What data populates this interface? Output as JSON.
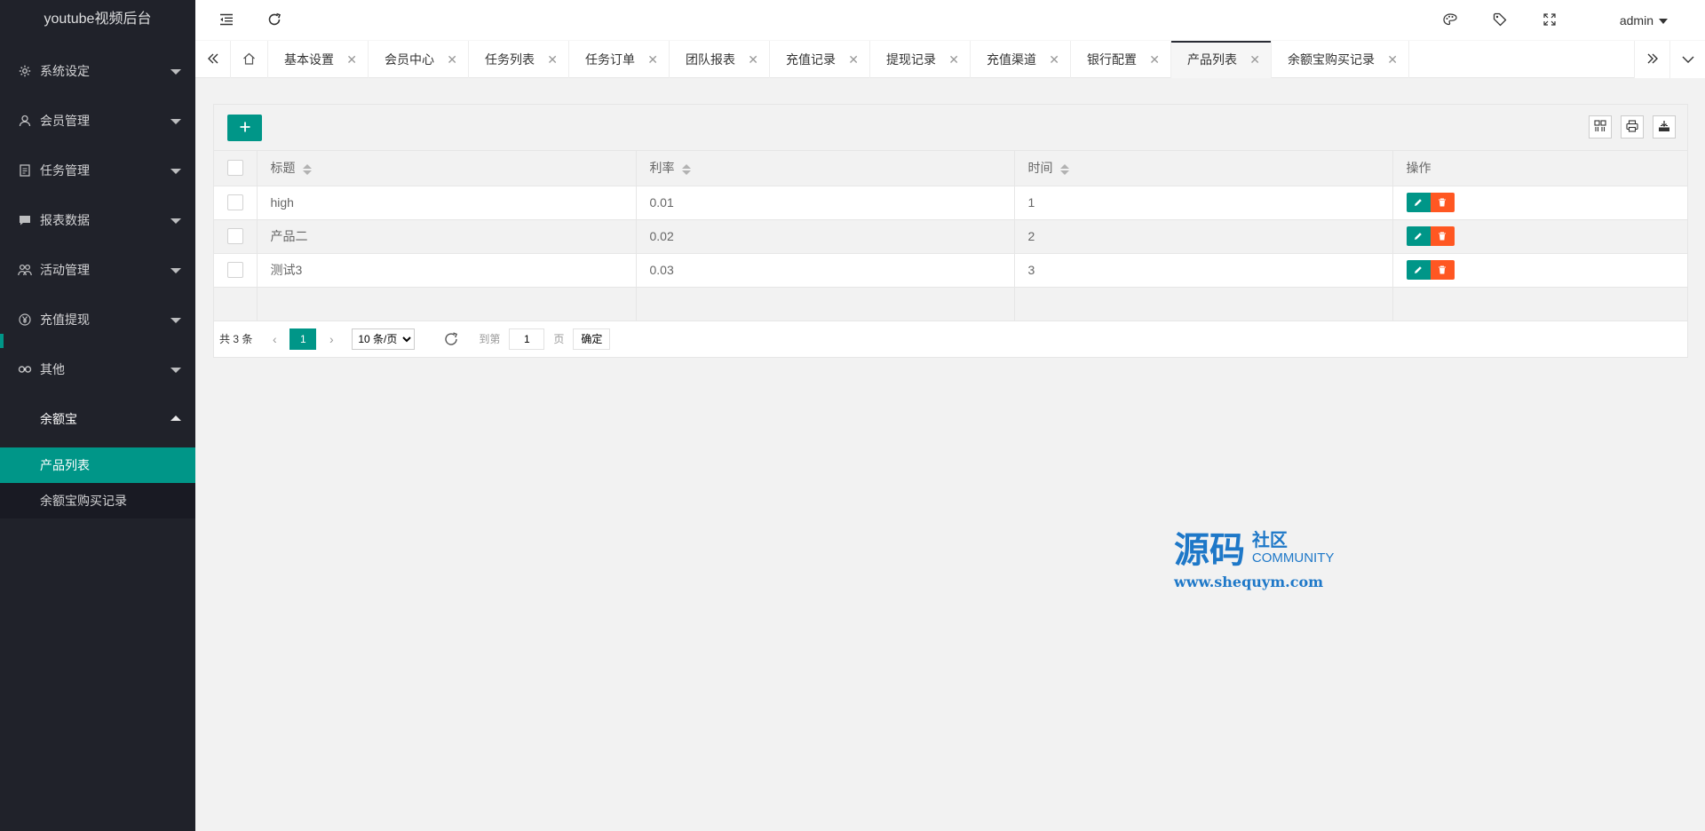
{
  "app": {
    "title": "youtube视频后台"
  },
  "sidebar": {
    "items": [
      {
        "label": "系统设定",
        "icon": "gear-icon"
      },
      {
        "label": "会员管理",
        "icon": "user-icon"
      },
      {
        "label": "任务管理",
        "icon": "document-icon"
      },
      {
        "label": "报表数据",
        "icon": "chat-icon"
      },
      {
        "label": "活动管理",
        "icon": "group-icon"
      },
      {
        "label": "充值提现",
        "icon": "yen-icon"
      },
      {
        "label": "其他",
        "icon": "link-icon"
      },
      {
        "label": "余额宝",
        "icon": ""
      }
    ],
    "subitems": [
      "产品列表",
      "余额宝购买记录"
    ]
  },
  "header": {
    "user": "admin"
  },
  "tabs": [
    "基本设置",
    "会员中心",
    "任务列表",
    "任务订单",
    "团队报表",
    "充值记录",
    "提现记录",
    "充值渠道",
    "银行配置",
    "产品列表",
    "余额宝购买记录"
  ],
  "table": {
    "columns": [
      "标题",
      "利率",
      "时间",
      "操作"
    ],
    "rows": [
      {
        "title": "high",
        "rate": "0.01",
        "time": "1"
      },
      {
        "title": "产品二",
        "rate": "0.02",
        "time": "2"
      },
      {
        "title": "测试3",
        "rate": "0.03",
        "time": "3"
      }
    ]
  },
  "pager": {
    "total": "共 3 条",
    "current": "1",
    "page_size": "10 条/页",
    "goto_label": "到第",
    "goto_value": "1",
    "page_unit": "页",
    "confirm": "确定"
  },
  "watermark": {
    "big": "源码",
    "small1": "社区",
    "small2": "COMMUNITY",
    "url": "www.shequym.com"
  },
  "colors": {
    "accent": "#009688",
    "danger": "#ff5722",
    "sidebar": "#20222a"
  }
}
